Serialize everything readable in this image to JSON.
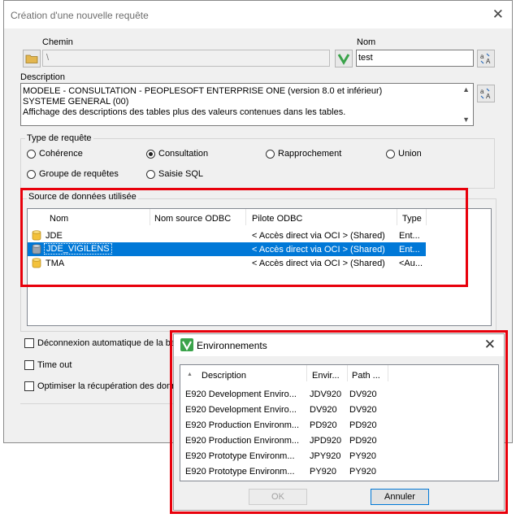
{
  "window": {
    "title": "Création d'une nouvelle requête",
    "close_glyph": "✕"
  },
  "chemin": {
    "label": "Chemin",
    "value": "\\"
  },
  "nom": {
    "label": "Nom",
    "value": "test"
  },
  "description": {
    "label": "Description",
    "lines": [
      "MODELE - CONSULTATION - PEOPLESOFT ENTERPRISE ONE (version 8.0 et inférieur)",
      "SYSTEME GENERAL (00)",
      "Affichage des descriptions des tables plus des valeurs contenues dans les tables."
    ]
  },
  "type_requete": {
    "label": "Type de requête",
    "options": [
      {
        "label": "Cohérence",
        "selected": false
      },
      {
        "label": "Consultation",
        "selected": true
      },
      {
        "label": "Rapprochement",
        "selected": false
      },
      {
        "label": "Union",
        "selected": false
      },
      {
        "label": "Groupe de requêtes",
        "selected": false
      },
      {
        "label": "Saisie SQL",
        "selected": false
      }
    ]
  },
  "source": {
    "label": "Source de données utilisée",
    "columns": [
      "Nom",
      "Nom source ODBC",
      "Pilote ODBC",
      "Type"
    ],
    "rows": [
      {
        "nom": "JDE",
        "odbc": "",
        "pilote": "< Accès direct via OCI > (Shared)",
        "type": "Ent...",
        "selected": false
      },
      {
        "nom": "JDE_VIGILENS",
        "odbc": "",
        "pilote": "< Accès direct via OCI > (Shared)",
        "type": "Ent...",
        "selected": true
      },
      {
        "nom": "TMA",
        "odbc": "",
        "pilote": "< Accès direct via OCI > (Shared)",
        "type": "<Au...",
        "selected": false
      }
    ]
  },
  "options": {
    "deconnexion": "Déconnexion automatique de la ba",
    "timeout": "Time out",
    "optimiser": "Optimiser la récupération des donne"
  },
  "env_dialog": {
    "title": "Environnements",
    "close_glyph": "✕",
    "columns": [
      "Description",
      "Envir...",
      "Path ..."
    ],
    "sort_glyph": "▲",
    "rows": [
      {
        "desc": "E920 Development Enviro...",
        "env": "JDV920",
        "path": "DV920"
      },
      {
        "desc": "E920 Development Enviro...",
        "env": "DV920",
        "path": "DV920"
      },
      {
        "desc": "E920 Production Environm...",
        "env": "PD920",
        "path": "PD920"
      },
      {
        "desc": "E920 Production Environm...",
        "env": "JPD920",
        "path": "PD920"
      },
      {
        "desc": "E920 Prototype Environm...",
        "env": "JPY920",
        "path": "PY920"
      },
      {
        "desc": "E920 Prototype Environm...",
        "env": "PY920",
        "path": "PY920"
      }
    ],
    "ok_label": "OK",
    "cancel_label": "Annuler"
  },
  "colors": {
    "highlight": "#0078d7",
    "annotation_red": "#e8000b",
    "brand_green": "#3aa34a"
  }
}
